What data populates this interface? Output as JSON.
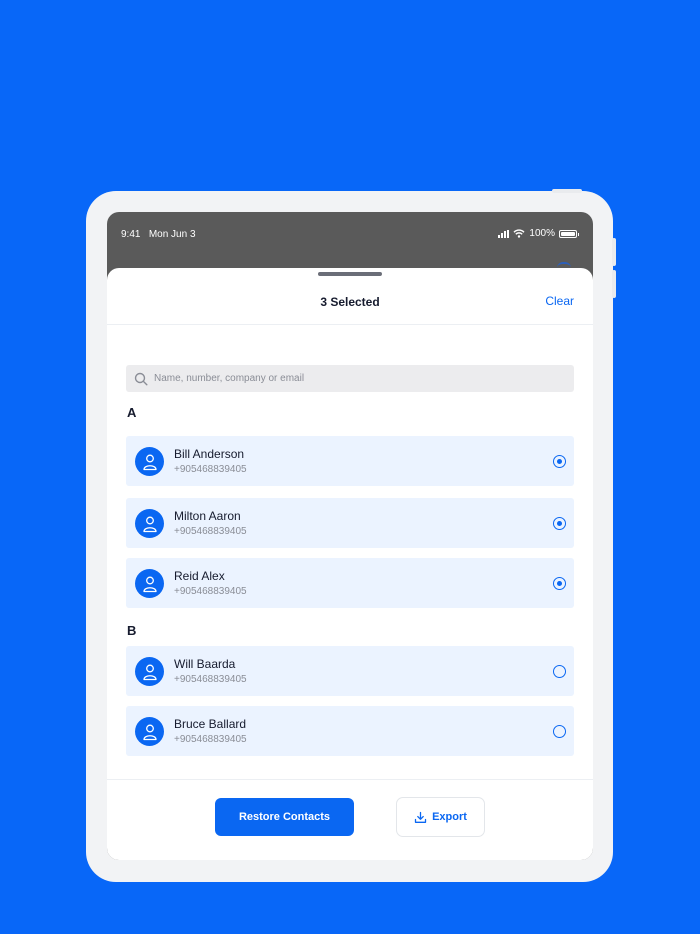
{
  "status_bar": {
    "time": "9:41",
    "date": "Mon Jun 3",
    "battery": "100%"
  },
  "sheet": {
    "title": "3 Selected",
    "clear_label": "Clear"
  },
  "search": {
    "placeholder": "Name, number, company or email"
  },
  "sections": [
    {
      "letter": "A",
      "contacts": [
        {
          "name": "Bill Anderson",
          "phone": "+905468839405",
          "selected": true
        },
        {
          "name": "Milton Aaron",
          "phone": "+905468839405",
          "selected": true
        },
        {
          "name": "Reid Alex",
          "phone": "+905468839405",
          "selected": true
        }
      ]
    },
    {
      "letter": "B",
      "contacts": [
        {
          "name": "Will Baarda",
          "phone": "+905468839405",
          "selected": false
        },
        {
          "name": "Bruce Ballard",
          "phone": "+905468839405",
          "selected": false
        }
      ]
    }
  ],
  "footer": {
    "restore_label": "Restore Contacts",
    "export_label": "Export"
  },
  "colors": {
    "background": "#0867f8",
    "accent": "#0a67f2",
    "row_bg": "#ebf3ff"
  },
  "icons": [
    "search-icon",
    "user-icon",
    "radio-icon",
    "download-icon",
    "wifi-icon",
    "battery-icon",
    "signal-icon"
  ]
}
